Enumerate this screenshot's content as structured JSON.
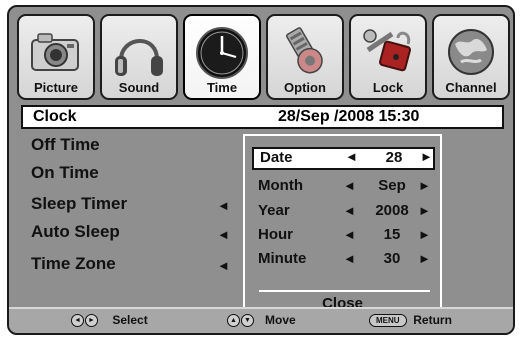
{
  "tabs": [
    {
      "label": "Picture",
      "icon": "camera-icon",
      "active": false
    },
    {
      "label": "Sound",
      "icon": "headphones-icon",
      "active": false
    },
    {
      "label": "Time",
      "icon": "clock-icon",
      "active": true
    },
    {
      "label": "Option",
      "icon": "gear-icon",
      "active": false
    },
    {
      "label": "Lock",
      "icon": "lock-icon",
      "active": false
    },
    {
      "label": "Channel",
      "icon": "globe-icon",
      "active": false
    }
  ],
  "clock": {
    "label": "Clock",
    "value": "28/Sep  /2008 15:30"
  },
  "menu": {
    "items": [
      {
        "label": "Off Time"
      },
      {
        "label": "On Time"
      },
      {
        "label": "Sleep Timer"
      },
      {
        "label": "Auto Sleep"
      },
      {
        "label": "Time Zone"
      }
    ],
    "arrow": "◄"
  },
  "popup": {
    "rows": [
      {
        "label": "Date",
        "value": "28"
      },
      {
        "label": "Month",
        "value": "Sep"
      },
      {
        "label": "Year",
        "value": "2008"
      },
      {
        "label": "Hour",
        "value": "15"
      },
      {
        "label": "Minute",
        "value": "30"
      }
    ],
    "left_arrow": "◄",
    "right_arrow": "►",
    "close_label": "Close"
  },
  "help": {
    "select_label": "Select",
    "move_label": "Move",
    "menu_key": "MENU",
    "return_label": "Return"
  },
  "colors": {
    "panel": "#8f8f8f",
    "highlight": "#ffffff",
    "text": "#111111"
  }
}
